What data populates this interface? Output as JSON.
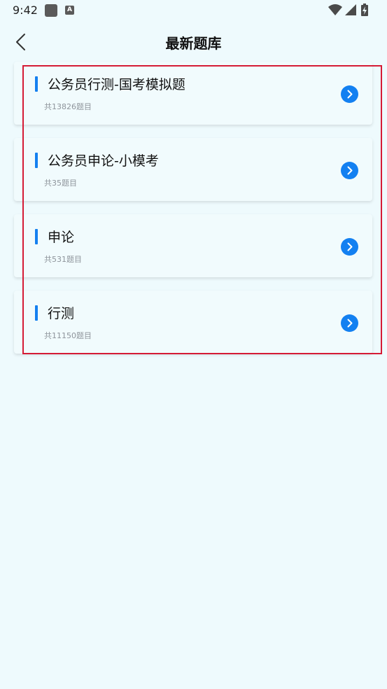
{
  "status_bar": {
    "time": "9:42",
    "a_badge": "A"
  },
  "header": {
    "title": "最新题库"
  },
  "items": [
    {
      "title": "公务员行测-国考模拟题",
      "count": "共13826题目"
    },
    {
      "title": "公务员申论-小模考",
      "count": "共35题目"
    },
    {
      "title": "申论",
      "count": "共531题目"
    },
    {
      "title": "行测",
      "count": "共11150题目"
    }
  ],
  "colors": {
    "background": "#eefafd",
    "accent": "#1580ef",
    "highlight": "#d51b35"
  },
  "icons": {
    "back": "chevron-left-icon",
    "item_arrow": "chevron-right-circle-icon",
    "wifi": "wifi-icon",
    "signal": "signal-icon",
    "battery": "battery-icon"
  }
}
